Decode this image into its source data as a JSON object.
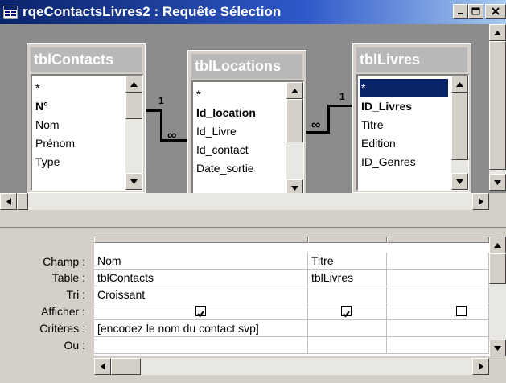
{
  "window": {
    "title": "rqeContactsLivres2 : Requête Sélection",
    "title_color": "#ffffff",
    "titlebar_color": "#0a246a"
  },
  "tables": [
    {
      "name": "tblContacts",
      "fields": [
        "*",
        "N°",
        "Nom",
        "Prénom",
        "Type"
      ]
    },
    {
      "name": "tblLocations",
      "fields": [
        "*",
        "Id_location",
        "Id_Livre",
        "Id_contact",
        "Date_sortie"
      ]
    },
    {
      "name": "tblLivres",
      "fields": [
        "*",
        "ID_Livres",
        "Titre",
        "Edition",
        "ID_Genres"
      ]
    }
  ],
  "relations": [
    {
      "from": "tblContacts",
      "to": "tblLocations",
      "one_label": "1",
      "many_label": "∞"
    },
    {
      "from": "tblLivres",
      "to": "tblLocations",
      "one_label": "1",
      "many_label": "∞"
    }
  ],
  "grid": {
    "row_labels": [
      "Champ :",
      "Table :",
      "Tri :",
      "Afficher :",
      "Critères :",
      "Ou :"
    ],
    "columns": [
      {
        "champ": "Nom",
        "table": "tblContacts",
        "tri": "Croissant",
        "afficher": true,
        "criteres": "[encodez le nom du contact svp]",
        "ou": ""
      },
      {
        "champ": "Titre",
        "table": "tblLivres",
        "tri": "",
        "afficher": true,
        "criteres": "",
        "ou": ""
      },
      {
        "champ": "",
        "table": "",
        "tri": "",
        "afficher": false,
        "criteres": "",
        "ou": ""
      }
    ]
  },
  "icons": [
    "query-window-icon",
    "minimize-icon",
    "maximize-icon",
    "close-icon",
    "scroll-up-arrow-icon",
    "scroll-down-arrow-icon",
    "scroll-left-arrow-icon",
    "scroll-right-arrow-icon",
    "checkbox-checked-icon"
  ],
  "colors": {
    "design_background": "#8c8c8c",
    "selection": "#0a246a",
    "face": "#d4d0c8"
  }
}
